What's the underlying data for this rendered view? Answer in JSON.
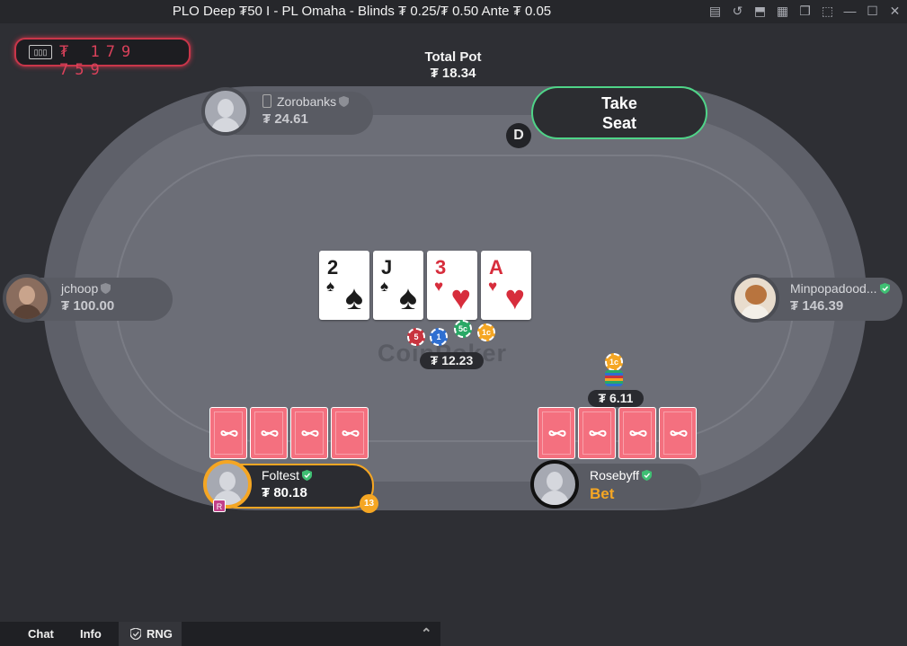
{
  "window": {
    "title": "PLO Deep ₮50 I - PL Omaha - Blinds ₮ 0.25/₮ 0.50 Ante ₮ 0.05"
  },
  "balance": {
    "amount": "₮ 179 759"
  },
  "pot": {
    "label": "Total Pot",
    "total": "₮ 18.34",
    "main": "₮ 12.23"
  },
  "take_seat": {
    "line1": "Take",
    "line2": "Seat"
  },
  "dealer": {
    "label": "D"
  },
  "watermark": "CoinPoker",
  "board": [
    {
      "rank": "2",
      "suit": "♠",
      "color": "#1c1c1c"
    },
    {
      "rank": "J",
      "suit": "♠",
      "color": "#1c1c1c"
    },
    {
      "rank": "3",
      "suit": "♥",
      "color": "#d72d3c"
    },
    {
      "rank": "A",
      "suit": "♥",
      "color": "#d72d3c"
    }
  ],
  "pot_chips": [
    "5",
    "1",
    "5c",
    "1c"
  ],
  "players": {
    "zorobanks": {
      "name": "Zorobanks",
      "stack": "₮ 24.61"
    },
    "jchoop": {
      "name": "jchoop",
      "stack": "₮ 100.00"
    },
    "minpopadood": {
      "name": "Minpopadood...",
      "stack": "₮ 146.39"
    },
    "foltest": {
      "name": "Foltest",
      "stack": "₮ 80.18",
      "timer": "13",
      "badge": "R"
    },
    "rosebyff": {
      "name": "Rosebyff",
      "action": "Bet",
      "bet": "₮ 6.11",
      "bet_chip": "1c"
    }
  },
  "colors": {
    "accent_green": "#4fd488",
    "accent_orange": "#f5a623",
    "card_back": "#f4707f",
    "balance_red": "#d9415a"
  },
  "bottom_tabs": {
    "chat": "Chat",
    "info": "Info",
    "rng": "RNG"
  }
}
